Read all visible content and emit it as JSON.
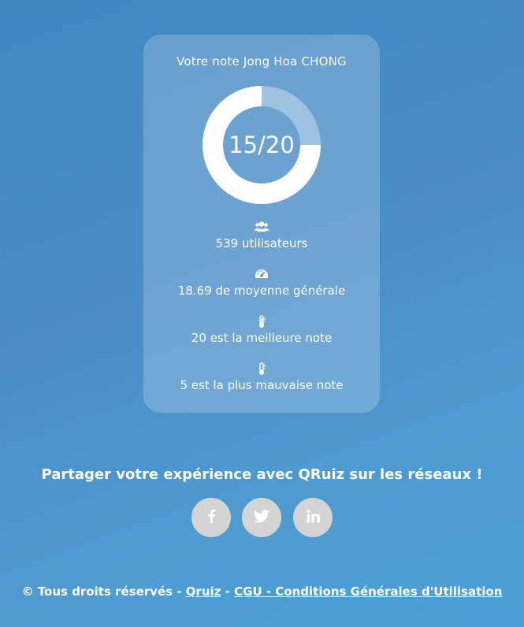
{
  "result": {
    "title": "Votre note Jong Hoa CHONG",
    "score_text": "15/20",
    "score": 15,
    "max_score": 20,
    "stats": [
      {
        "icon": "users-icon",
        "text": "539 utilisateurs"
      },
      {
        "icon": "gauge-icon",
        "text": "18.69 de moyenne générale"
      },
      {
        "icon": "thermometer-icon",
        "text": "20 est la meilleure note"
      },
      {
        "icon": "thermometer-icon",
        "text": "5 est la plus mauvaise note"
      }
    ]
  },
  "share": {
    "title": "Partager votre expérience avec QRuiz sur les réseaux !",
    "networks": [
      {
        "icon": "facebook-icon"
      },
      {
        "icon": "twitter-icon"
      },
      {
        "icon": "linkedin-icon"
      }
    ]
  },
  "footer": {
    "copyright": "© Tous droits réservés -",
    "sep1": "-",
    "link_qruiz": "Qruiz",
    "link_cgu": "CGU - Conditions Générales d'Utilisation"
  },
  "colors": {
    "background": "#4a8dc8",
    "gauge_fill": "#ffffff",
    "gauge_track": "rgba(255,255,255,0.35)",
    "social_button": "#d4d4d4"
  }
}
